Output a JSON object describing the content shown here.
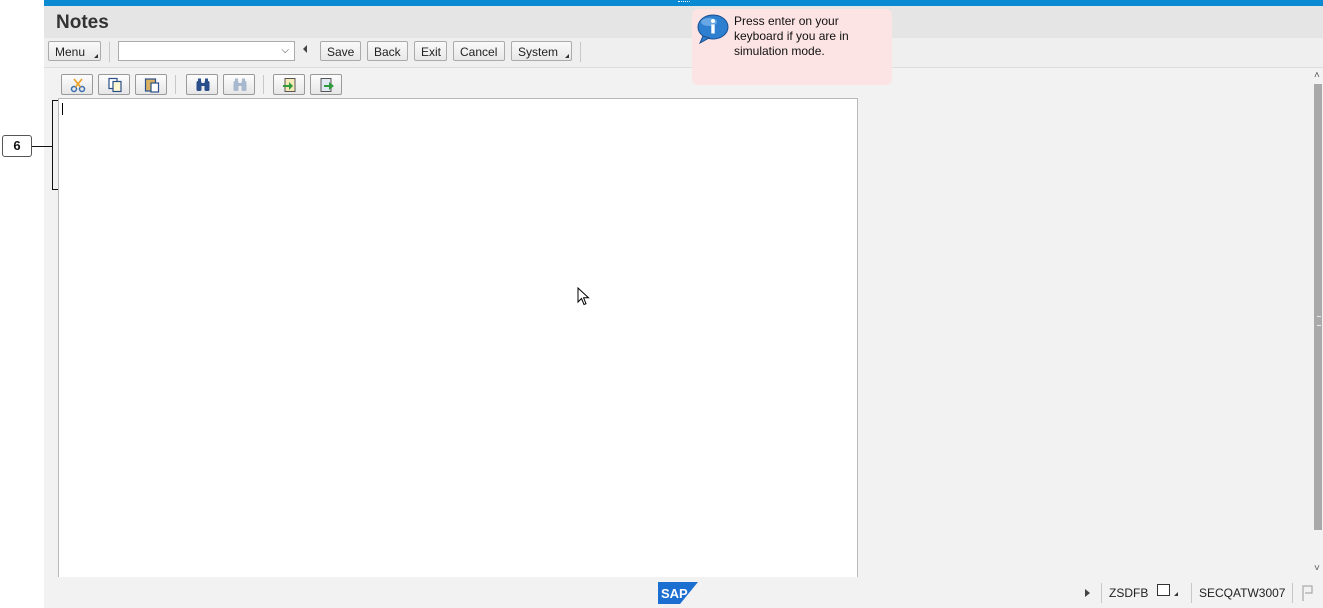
{
  "window": {
    "title": "Notes"
  },
  "toolbar": {
    "menu_label": "Menu",
    "command_field_value": "",
    "save_label": "Save",
    "back_label": "Back",
    "exit_label": "Exit",
    "cancel_label": "Cancel",
    "system_label": "System"
  },
  "editor_toolbar": {
    "icons": [
      "cut-icon",
      "copy-icon",
      "paste-icon",
      "find-icon",
      "find-next-icon",
      "import-icon",
      "export-icon"
    ]
  },
  "editor": {
    "content": ""
  },
  "tooltip": {
    "text": "Press enter on your keyboard if you are in simulation mode."
  },
  "callout": {
    "number": "6"
  },
  "statusbar": {
    "logo": "SAP",
    "system_id": "ZSDFB",
    "server": "SECQATW3007"
  },
  "colors": {
    "accent": "#0a8ad2",
    "tooltip_bg": "#fde4e4",
    "sap_logo_blue": "#1b6fd1"
  }
}
